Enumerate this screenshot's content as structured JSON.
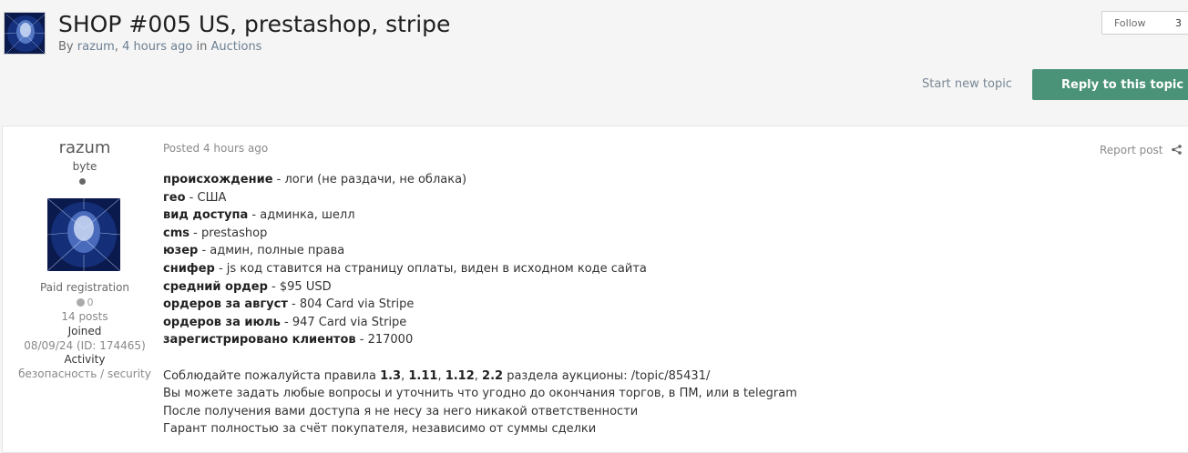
{
  "topic": {
    "title": "SHOP #005 US, prestashop, stripe",
    "by_prefix": "By",
    "author": "razum",
    "time": "4 hours ago",
    "in_word": "in",
    "forum": "Auctions"
  },
  "actions": {
    "follow_label": "Follow",
    "follow_count": "3",
    "start_new_topic": "Start new topic",
    "reply_label": "Reply to this topic"
  },
  "author_panel": {
    "name": "razum",
    "rank": "byte",
    "group": "Paid registration",
    "reputation": "0",
    "posts": "14 posts",
    "joined_label": "Joined",
    "joined_value": "08/09/24 (ID: 174465)",
    "activity_label": "Activity",
    "activity_value": "безопасность / security"
  },
  "post": {
    "posted_prefix": "Posted",
    "posted_time": "4 hours ago",
    "report_label": "Report post",
    "fields": [
      {
        "label": "происхождение",
        "value": "логи (не раздачи, не облака)",
        "bold_value": false
      },
      {
        "label": "гео",
        "value": "США",
        "bold_value": false
      },
      {
        "label": "вид доступа",
        "value": "админка, шелл",
        "bold_value": false
      },
      {
        "label": "cms",
        "value": "prestashop",
        "bold_value": false
      },
      {
        "label": "юзер",
        "value": "админ, полные права",
        "bold_value": false
      },
      {
        "label": "снифер",
        "value": "js код ставится на страницу оплаты, виден в исходном коде сайта",
        "bold_value": false
      },
      {
        "label": "средний ордер",
        "value": "$95 USD",
        "bold_value": false
      },
      {
        "label": "ордеров за август",
        "value": "804 Card via Stripe",
        "bold_value": false
      },
      {
        "label": "ордеров за июль",
        "value": "947 Card via Stripe",
        "bold_value": false
      },
      {
        "label": "зарегистрировано клиентов",
        "value": "217000",
        "bold_value": false
      }
    ],
    "rules": {
      "prefix": "Соблюдайте пожалуйста правила",
      "r1": "1.3",
      "r2": "1.11",
      "r3": "1.12",
      "r4": "2.2",
      "suffix": "раздела аукционы: /topic/85431/"
    },
    "notes": [
      "Вы можете задать любые вопросы и уточнить что угодно до окончания торгов, в ПМ, или в telegram",
      "После получения вами доступа я не несу за него никакой ответственности",
      "Гарант полностью за счёт покупателя, независимо от суммы сделки"
    ]
  },
  "colors": {
    "reply_button": "#4a9378",
    "link": "#6b7f91",
    "background": "#f5f5f5"
  },
  "icons": {
    "share": "share-icon",
    "avatar": "neural-head-avatar"
  }
}
